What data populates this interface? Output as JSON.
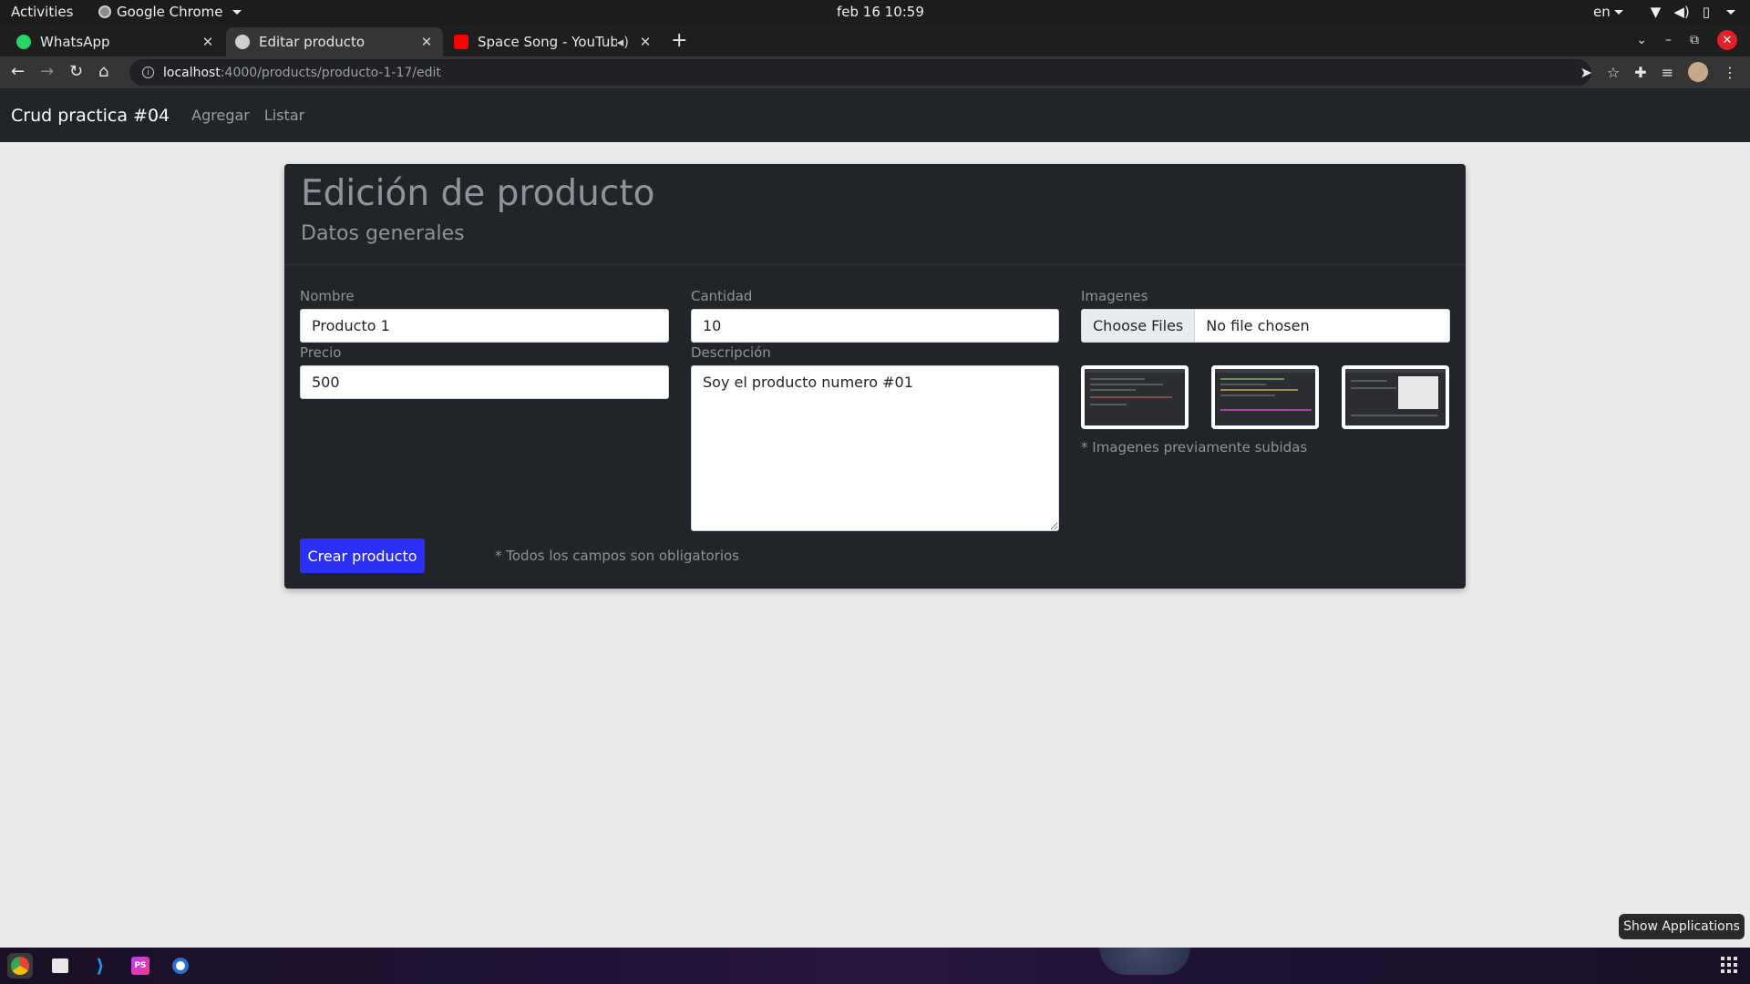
{
  "topbar": {
    "activities": "Activities",
    "app_name": "Google Chrome",
    "clock": "feb 16  10:59",
    "lang": "en"
  },
  "tabs": [
    {
      "label": "WhatsApp",
      "icon": "whatsapp-icon",
      "color": "#25d366"
    },
    {
      "label": "Editar producto",
      "icon": "globe-icon",
      "color": "#cfcfcf"
    },
    {
      "label": "Space Song - YouTube",
      "icon": "youtube-icon",
      "color": "#ff0000"
    }
  ],
  "toolbar": {
    "url_host": "localhost",
    "url_path": ":4000/products/producto-1-17/edit"
  },
  "navbar": {
    "brand": "Crud practica #04",
    "links": [
      "Agregar",
      "Listar"
    ]
  },
  "form": {
    "title": "Edición de producto",
    "subtitle": "Datos generales",
    "nombre_label": "Nombre",
    "nombre_value": "Producto 1",
    "precio_label": "Precio",
    "precio_value": "500",
    "cantidad_label": "Cantidad",
    "cantidad_value": "10",
    "descripcion_label": "Descripción",
    "descripcion_value": "Soy el producto numero #01",
    "imagenes_label": "Imagenes",
    "choose_files": "Choose Files",
    "no_file": "No file chosen",
    "images_hint": "* Imagenes previamente subidas",
    "submit_label": "Crear producto",
    "required_hint": "* Todos los campos son obligatorios"
  },
  "tooltip": "Show Applications",
  "dock": [
    {
      "name": "chrome-icon",
      "glyph": "",
      "color": "#4285f4"
    },
    {
      "name": "files-icon",
      "glyph": "",
      "color": "#e8e8e8"
    },
    {
      "name": "vscode-icon",
      "glyph": "",
      "color": "#1f9cf0"
    },
    {
      "name": "phpstorm-icon",
      "glyph": "PS",
      "color": "#b345f1"
    },
    {
      "name": "app-icon",
      "glyph": "",
      "color": "#2b6fd6"
    }
  ],
  "colors": {
    "primary": "#2c2ff5",
    "card_bg": "#212529",
    "page_bg": "#ebebeb"
  }
}
